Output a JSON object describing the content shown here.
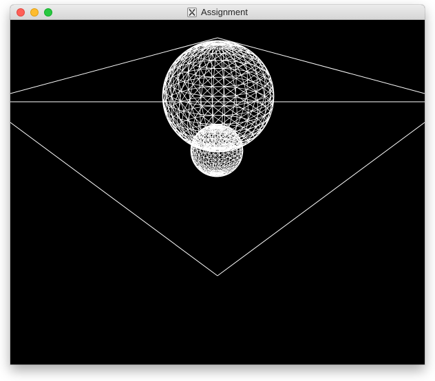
{
  "window": {
    "title": "Assignment",
    "app_icon": "x11-icon"
  },
  "traffic_lights": [
    {
      "name": "close",
      "color": "#fe5f57",
      "border": "#e2463f"
    },
    {
      "name": "minimize",
      "color": "#febc2e",
      "border": "#e1a116"
    },
    {
      "name": "zoom",
      "color": "#28c840",
      "border": "#14ae2a"
    }
  ],
  "scene": {
    "background": "#000000",
    "line_color": "#ffffff",
    "mode": "wireframe",
    "objects": [
      "ground-plane",
      "large-sphere",
      "small-sphere"
    ]
  }
}
